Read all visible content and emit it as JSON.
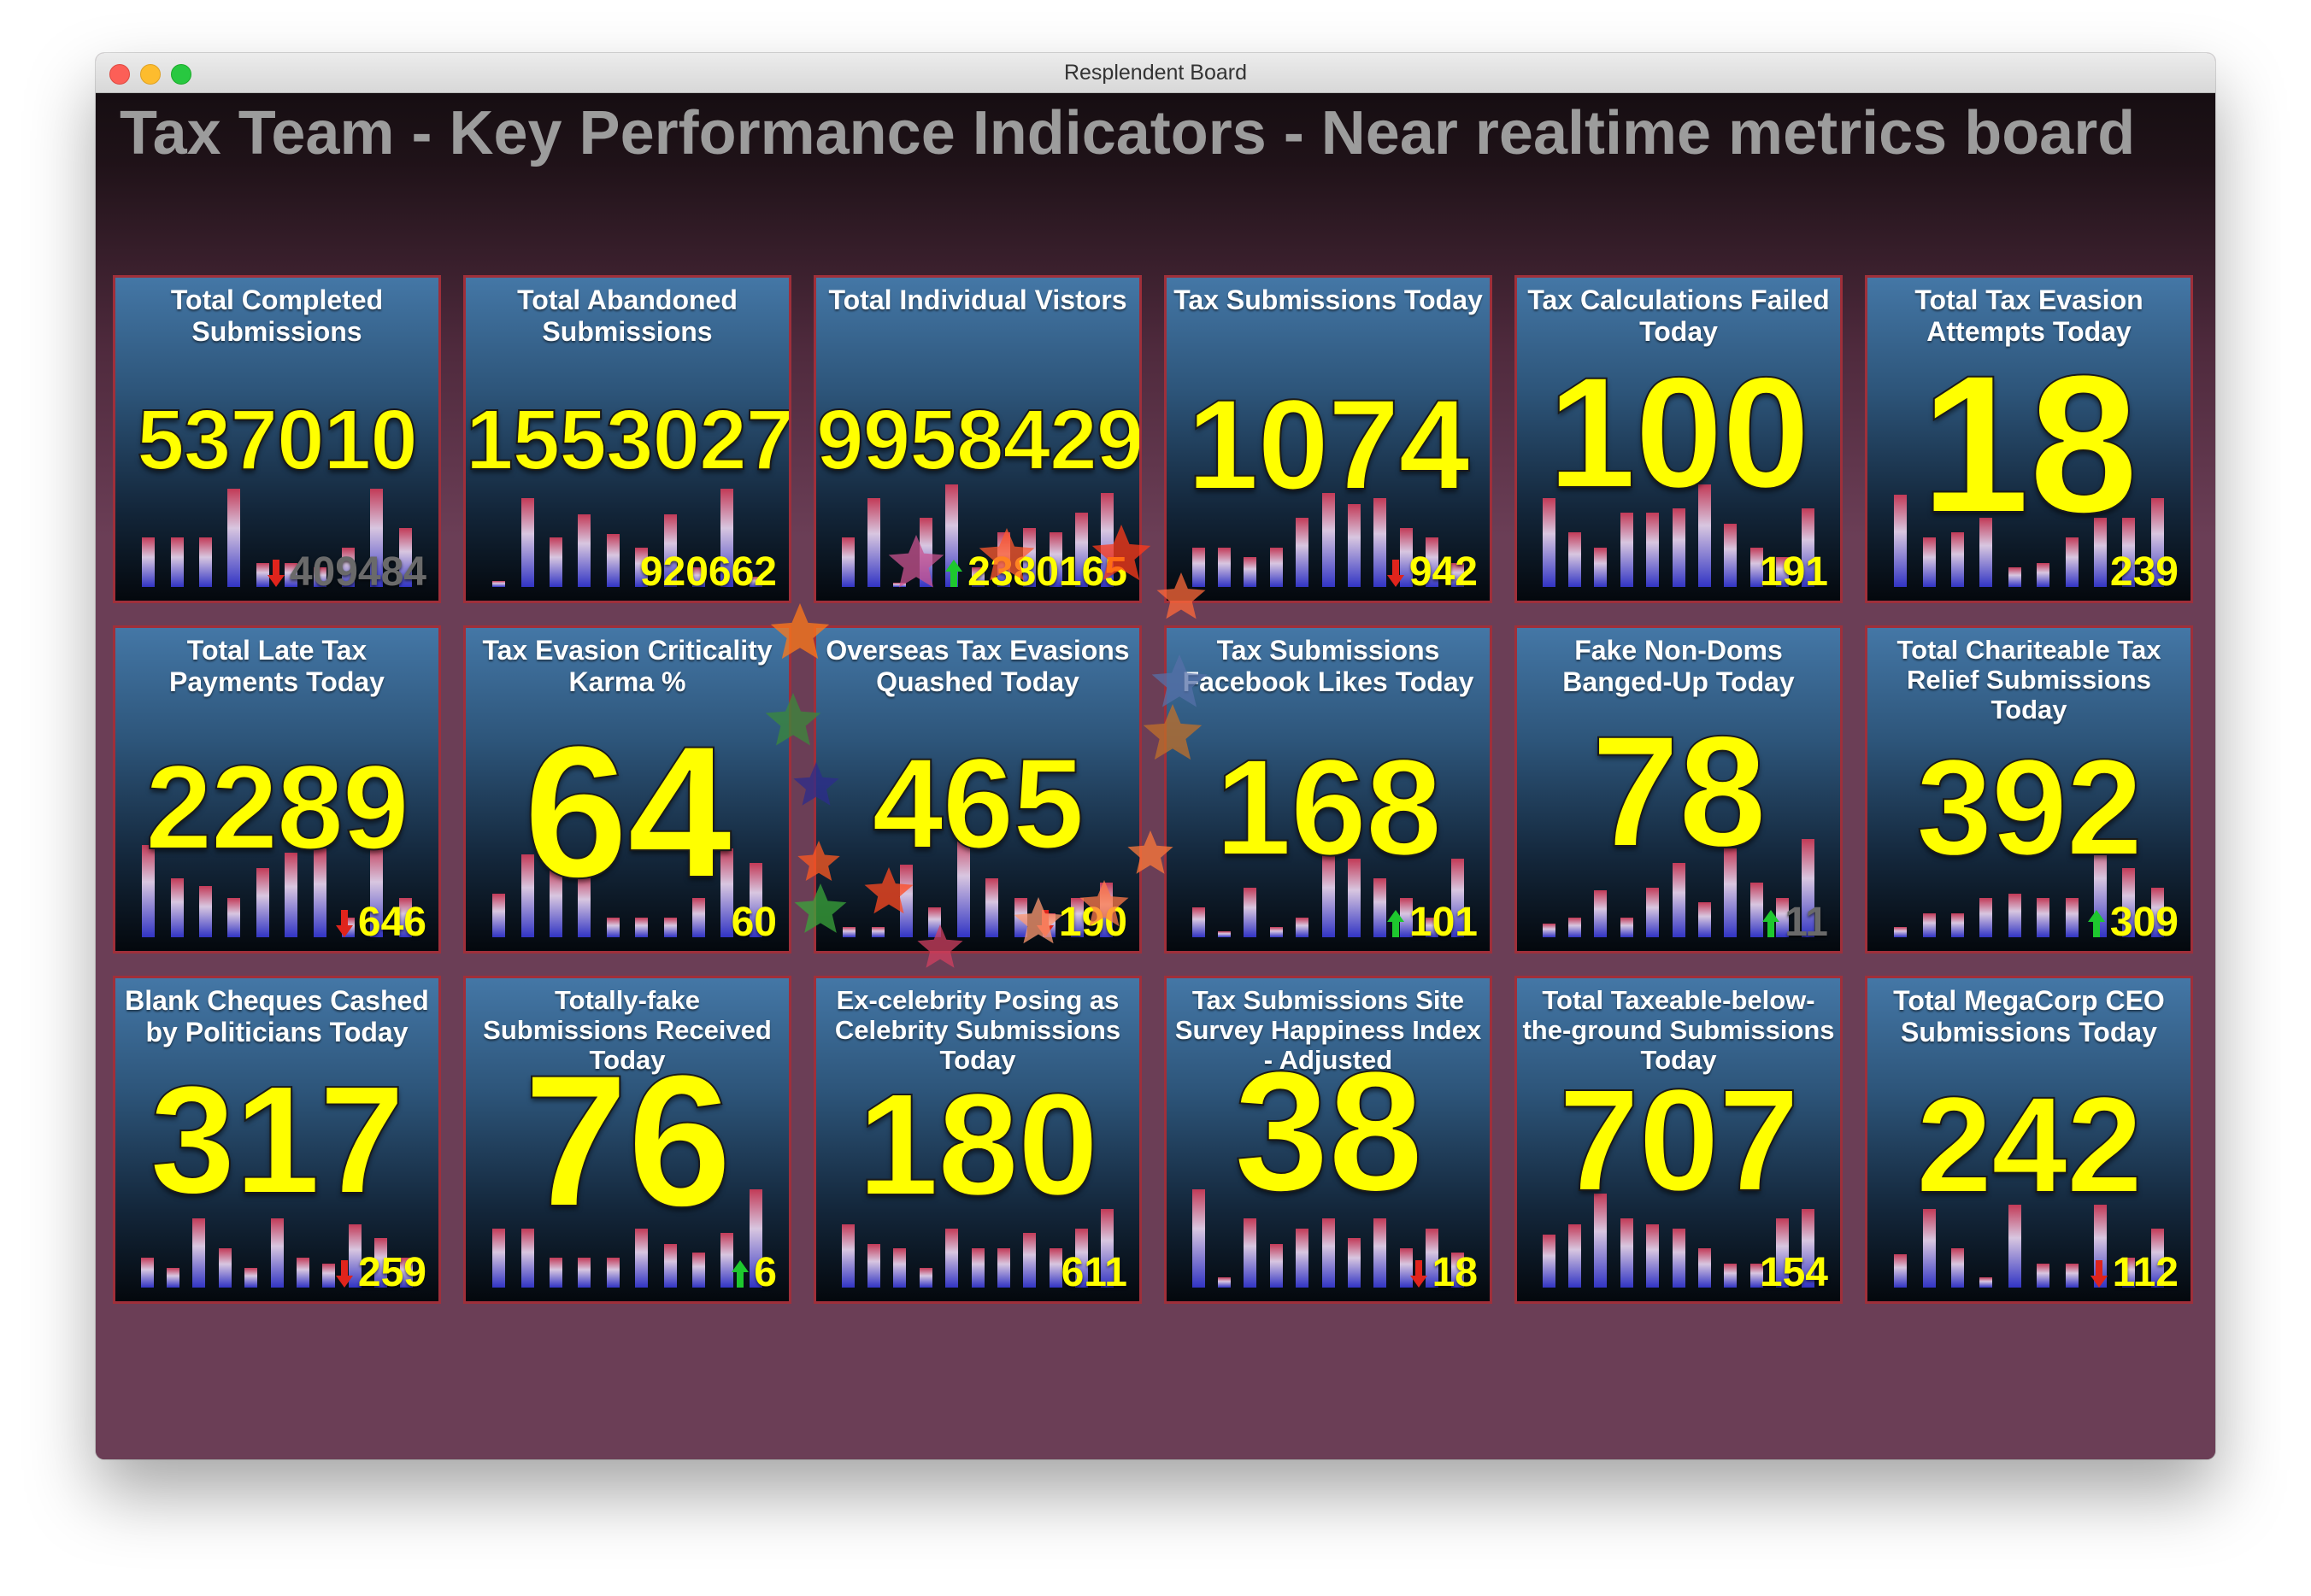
{
  "window": {
    "title": "Resplendent Board"
  },
  "board": {
    "title": "Tax Team - Key Performance Indicators - Near realtime metrics board"
  },
  "colors": {
    "background": "#6b3e56",
    "tile_border": "#9f2f3a",
    "value": "#ffff00",
    "arrow_up": "#1ec82e",
    "arrow_down": "#e0241c"
  },
  "tiles": [
    {
      "title": "Total Completed Submissions",
      "value": "537010",
      "previous": "409484",
      "trend": "down",
      "previous_faded": true,
      "bars": [
        0.25,
        0.25,
        0.25,
        0.5,
        0.12,
        0.12,
        0.1,
        0.2,
        0.5,
        0.3
      ]
    },
    {
      "title": "Total Abandoned Submissions",
      "value": "1553027",
      "previous": "920662",
      "trend": "none",
      "previous_faded": false,
      "bars": [
        0.03,
        0.45,
        0.25,
        0.37,
        0.27,
        0.2,
        0.37,
        0.1,
        0.5,
        0.05
      ]
    },
    {
      "title": "Total Individual Vistors",
      "value": "9958429",
      "previous": "2380165",
      "trend": "up",
      "previous_faded": false,
      "bars": [
        0.25,
        0.45,
        0.02,
        0.35,
        0.52,
        0.1,
        0.28,
        0.3,
        0.28,
        0.38,
        0.48
      ]
    },
    {
      "title": "Tax Submissions Today",
      "value": "1074",
      "previous": "942",
      "trend": "down",
      "previous_faded": false,
      "bars": [
        0.2,
        0.2,
        0.15,
        0.2,
        0.35,
        0.48,
        0.42,
        0.45,
        0.3,
        0.25,
        0.12
      ]
    },
    {
      "title": "Tax Calculations Failed Today",
      "value": "100",
      "previous": "191",
      "trend": "none",
      "previous_faded": false,
      "bars": [
        0.45,
        0.28,
        0.2,
        0.38,
        0.38,
        0.4,
        0.52,
        0.32,
        0.2,
        0.15,
        0.4
      ]
    },
    {
      "title": "Total Tax Evasion Attempts Today",
      "value": "18",
      "previous": "239",
      "trend": "none",
      "previous_faded": false,
      "bars": [
        0.47,
        0.25,
        0.28,
        0.35,
        0.1,
        0.12,
        0.25,
        0.35,
        0.35,
        0.45
      ]
    },
    {
      "title": "Total Late Tax Payments Today",
      "value": "2289",
      "previous": "646",
      "trend": "down",
      "previous_faded": false,
      "bars": [
        0.47,
        0.3,
        0.26,
        0.2,
        0.35,
        0.43,
        0.45,
        0.1,
        0.47,
        0.2
      ]
    },
    {
      "title": "Tax Evasion Criticality Karma %",
      "value": "64",
      "previous": "60",
      "trend": "none",
      "previous_faded": false,
      "bars": [
        0.22,
        0.42,
        0.35,
        0.32,
        0.1,
        0.1,
        0.1,
        0.2,
        0.45,
        0.38
      ]
    },
    {
      "title": "Overseas Tax Evasions Quashed Today",
      "value": "465",
      "previous": "190",
      "trend": "down",
      "previous_faded": false,
      "bars": [
        0.05,
        0.05,
        0.37,
        0.15,
        0.52,
        0.3,
        0.2,
        0.12,
        0.2,
        0.28
      ]
    },
    {
      "title": "Tax Submissions Facebook Likes Today",
      "value": "168",
      "previous": "101",
      "trend": "up",
      "previous_faded": false,
      "bars": [
        0.15,
        0.03,
        0.25,
        0.05,
        0.1,
        0.42,
        0.4,
        0.3,
        0.2,
        0.1,
        0.4
      ]
    },
    {
      "title": "Fake Non-Doms Banged-Up Today",
      "value": "78",
      "previous": "11",
      "trend": "up",
      "previous_faded": true,
      "bars": [
        0.07,
        0.1,
        0.24,
        0.1,
        0.25,
        0.38,
        0.18,
        0.45,
        0.28,
        0.2,
        0.5
      ]
    },
    {
      "title": "Total Chariteable Tax Relief Submissions Today",
      "value": "392",
      "previous": "309",
      "trend": "up",
      "previous_faded": false,
      "bars": [
        0.05,
        0.12,
        0.12,
        0.2,
        0.22,
        0.2,
        0.2,
        0.5,
        0.35,
        0.25
      ]
    },
    {
      "title": "Blank Cheques Cashed by Politicians Today",
      "value": "317",
      "previous": "259",
      "trend": "down",
      "previous_faded": false,
      "bars": [
        0.15,
        0.1,
        0.35,
        0.2,
        0.1,
        0.35,
        0.15,
        0.12,
        0.32,
        0.25,
        0.15
      ]
    },
    {
      "title": "Totally-fake Submissions Received Today",
      "value": "76",
      "previous": "6",
      "trend": "up",
      "previous_faded": false,
      "bars": [
        0.3,
        0.3,
        0.15,
        0.15,
        0.15,
        0.3,
        0.22,
        0.18,
        0.28,
        0.5
      ]
    },
    {
      "title": "Ex-celebrity Posing as Celebrity Submissions Today",
      "value": "180",
      "previous": "611",
      "trend": "none",
      "previous_faded": false,
      "bars": [
        0.32,
        0.22,
        0.2,
        0.1,
        0.3,
        0.2,
        0.2,
        0.28,
        0.2,
        0.3,
        0.4
      ]
    },
    {
      "title": "Tax Submissions Site Survey Happiness Index - Adjusted",
      "value": "38",
      "previous": "18",
      "trend": "down",
      "previous_faded": false,
      "bars": [
        0.5,
        0.05,
        0.35,
        0.22,
        0.3,
        0.35,
        0.25,
        0.35,
        0.2,
        0.3,
        0.18
      ]
    },
    {
      "title": "Total Taxeable-below-the-ground Submissions Today",
      "value": "707",
      "previous": "154",
      "trend": "none",
      "previous_faded": false,
      "bars": [
        0.27,
        0.32,
        0.48,
        0.35,
        0.32,
        0.3,
        0.2,
        0.12,
        0.12,
        0.35,
        0.4
      ]
    },
    {
      "title": "Total MegaCorp CEO Submissions Today",
      "value": "242",
      "previous": "112",
      "trend": "down",
      "previous_faded": false,
      "bars": [
        0.17,
        0.4,
        0.2,
        0.05,
        0.42,
        0.12,
        0.12,
        0.42,
        0.15,
        0.3
      ]
    }
  ]
}
